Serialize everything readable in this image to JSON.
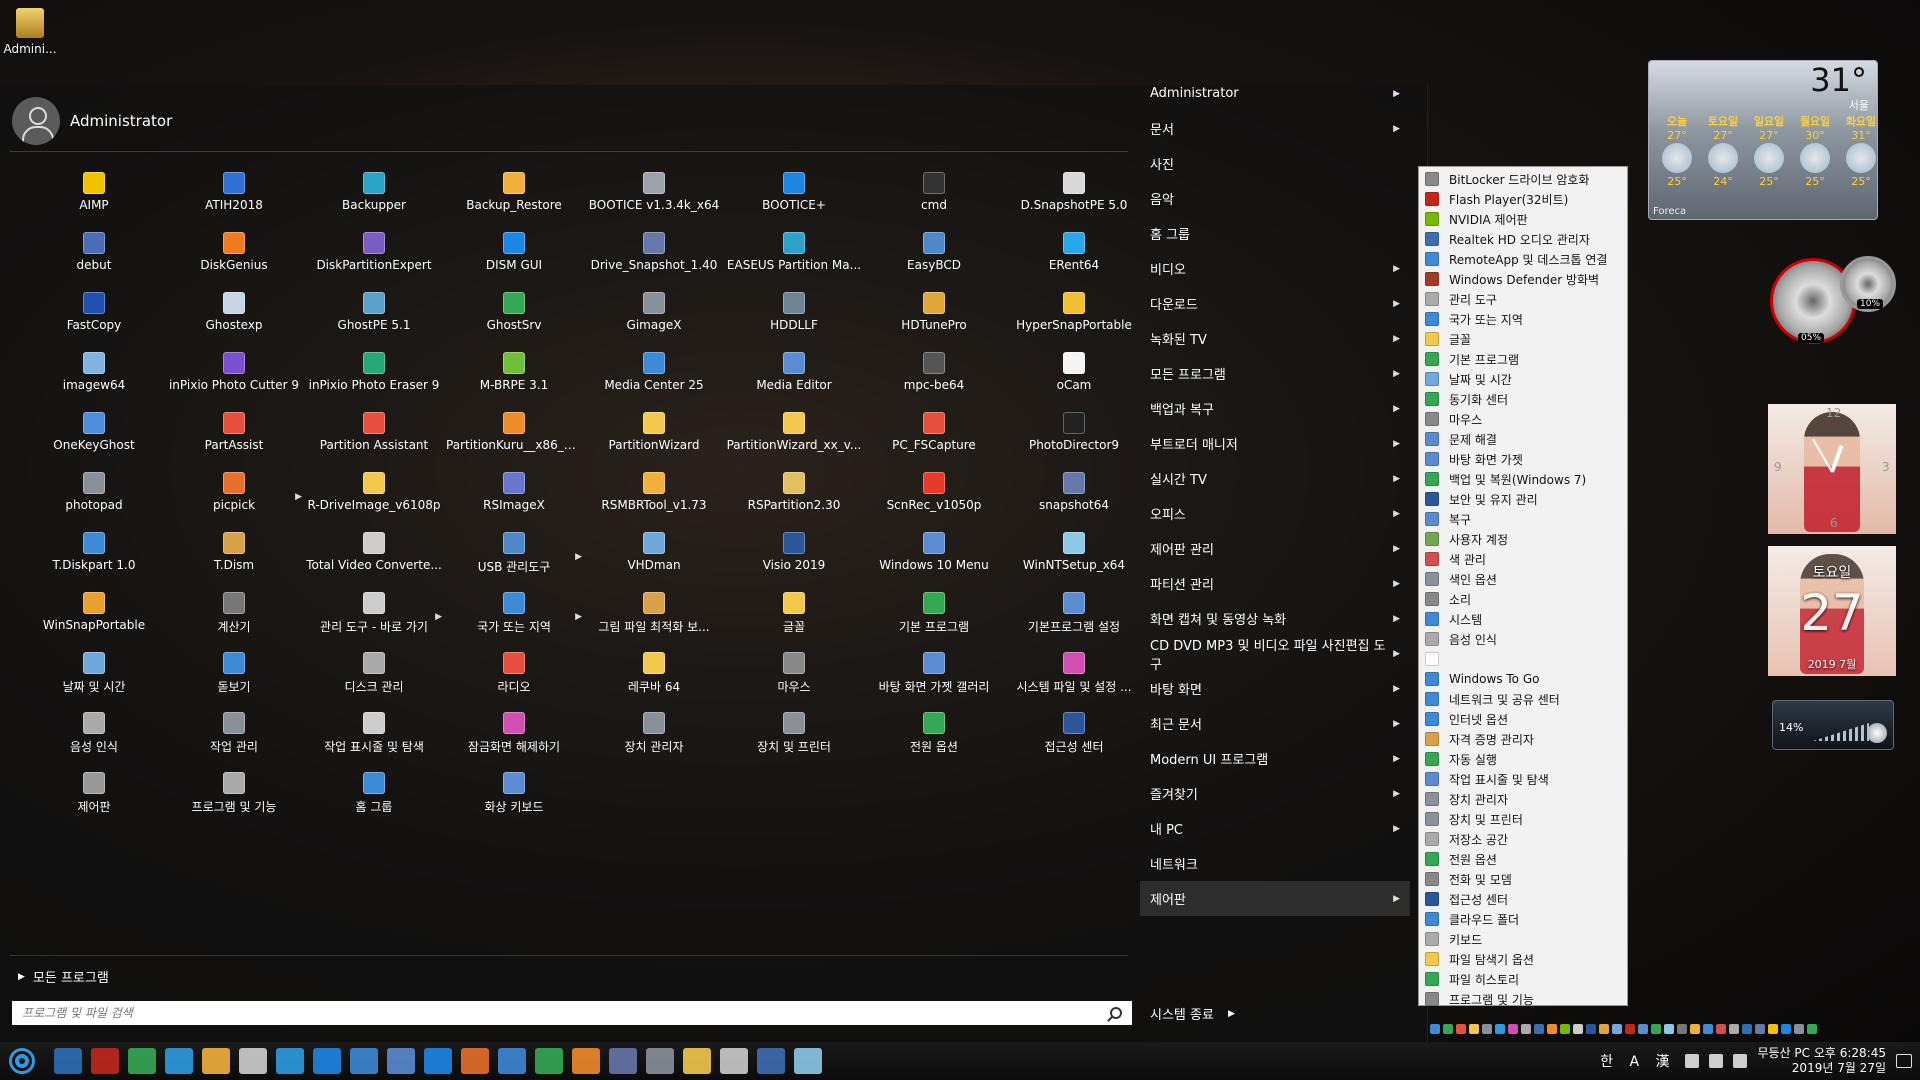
{
  "desktop_icons": [
    {
      "label": "Admini...",
      "icon": "admin-folder-icon"
    }
  ],
  "start_menu": {
    "user_name": "Administrator",
    "apps": [
      {
        "label": "AIMP",
        "color": "#f2c200"
      },
      {
        "label": "ATIH2018",
        "color": "#2f6fd6"
      },
      {
        "label": "Backupper",
        "color": "#2aa3c9"
      },
      {
        "label": "Backup_Restore",
        "color": "#f2b03b"
      },
      {
        "label": "BOOTICE v1.3.4k_x64",
        "color": "#9aa2ab"
      },
      {
        "label": "BOOTICE+",
        "color": "#1d86e3"
      },
      {
        "label": "cmd",
        "color": "#333333"
      },
      {
        "label": "D.SnapshotPE 5.0",
        "color": "#d9d9d9"
      },
      {
        "label": "debut",
        "color": "#4a6fb5"
      },
      {
        "label": "DiskGenius",
        "color": "#f07b1e"
      },
      {
        "label": "DiskPartitionExpert",
        "color": "#7d5cc2"
      },
      {
        "label": "DISM GUI",
        "color": "#1d86e3"
      },
      {
        "label": "Drive_Snapshot_1.40",
        "color": "#6677aa"
      },
      {
        "label": "EASEUS Partition Ma...",
        "color": "#2aa3c9"
      },
      {
        "label": "EasyBCD",
        "color": "#4f88c8"
      },
      {
        "label": "ERent64",
        "color": "#29a7e8"
      },
      {
        "label": "FastCopy",
        "color": "#2050b0"
      },
      {
        "label": "Ghostexp",
        "color": "#c7d6e4"
      },
      {
        "label": "GhostPE 5.1",
        "color": "#5aa0c9"
      },
      {
        "label": "GhostSrv",
        "color": "#34a853"
      },
      {
        "label": "GimageX",
        "color": "#8a9099"
      },
      {
        "label": "HDDLLF",
        "color": "#6f8595"
      },
      {
        "label": "HDTunePro",
        "color": "#e0a63a"
      },
      {
        "label": "HyperSnapPortable",
        "color": "#f0c030"
      },
      {
        "label": "imagew64",
        "color": "#7fb4e0"
      },
      {
        "label": "inPixio Photo Cutter 9",
        "color": "#7c4fd0"
      },
      {
        "label": "inPixio Photo Eraser 9",
        "color": "#27a77a"
      },
      {
        "label": "M-BRPE 3.1",
        "color": "#6fbf3a"
      },
      {
        "label": "Media Center 25",
        "color": "#3d8ad6"
      },
      {
        "label": "Media Editor",
        "color": "#5b8bd0"
      },
      {
        "label": "mpc-be64",
        "color": "#555555"
      },
      {
        "label": "oCam",
        "color": "#f5f5f5"
      },
      {
        "label": "OneKeyGhost",
        "color": "#4c8ed9"
      },
      {
        "label": "PartAssist",
        "color": "#e84f3d"
      },
      {
        "label": "Partition Assistant",
        "color": "#e84f3d"
      },
      {
        "label": "PartitionKuru__x86_x...",
        "color": "#f08b2a"
      },
      {
        "label": "PartitionWizard",
        "color": "#f2c94c"
      },
      {
        "label": "PartitionWizard_xx_v...",
        "color": "#f2c94c"
      },
      {
        "label": "PC_FSCapture",
        "color": "#e84f3d"
      },
      {
        "label": "PhotoDirector9",
        "color": "#222222"
      },
      {
        "label": "photopad",
        "color": "#8a9099"
      },
      {
        "label": "picpick",
        "color": "#e8702a",
        "arrow": true
      },
      {
        "label": "R-DriveImage_v6108p",
        "color": "#f2c94c"
      },
      {
        "label": "RSImageX",
        "color": "#6677cc"
      },
      {
        "label": "RSMBRTool_v1.73",
        "color": "#f2b03b"
      },
      {
        "label": "RSPartition2.30",
        "color": "#e0c060"
      },
      {
        "label": "ScnRec_v1050p",
        "color": "#e83a2a"
      },
      {
        "label": "snapshot64",
        "color": "#6677aa"
      },
      {
        "label": "T.Diskpart 1.0",
        "color": "#3d8ad6"
      },
      {
        "label": "T.Dism",
        "color": "#d9a24a"
      },
      {
        "label": "Total Video Converte...",
        "color": "#cccccc"
      },
      {
        "label": "USB 관리도구",
        "color": "#4f88c8",
        "arrow": true
      },
      {
        "label": "VHDman",
        "color": "#6fa8dc"
      },
      {
        "label": "Visio 2019",
        "color": "#2b579a"
      },
      {
        "label": "Windows 10 Menu",
        "color": "#5b8bd0"
      },
      {
        "label": "WinNTSetup_x64",
        "color": "#8ec9e8"
      },
      {
        "label": "WinSnapPortable",
        "color": "#e8a030"
      },
      {
        "label": "계산기",
        "color": "#777777"
      },
      {
        "label": "관리 도구 - 바로 가기",
        "color": "#cccccc",
        "arrow": true
      },
      {
        "label": "국가 또는 지역",
        "color": "#3d8ad6",
        "arrow": true
      },
      {
        "label": "그림 파일 최적화 보...",
        "color": "#d9a24a"
      },
      {
        "label": "글꼴",
        "color": "#f2c94c"
      },
      {
        "label": "기본 프로그램",
        "color": "#34a853"
      },
      {
        "label": "기본프로그램 설정",
        "color": "#5b8bd0"
      },
      {
        "label": "날짜 및 시간",
        "color": "#6fa8dc"
      },
      {
        "label": "돋보기",
        "color": "#3d8ad6"
      },
      {
        "label": "디스크 관리",
        "color": "#aaaaaa"
      },
      {
        "label": "라디오",
        "color": "#e84f3d"
      },
      {
        "label": "레쿠바 64",
        "color": "#f2c94c"
      },
      {
        "label": "마우스",
        "color": "#888888"
      },
      {
        "label": "바탕 화면 가젯 갤러리",
        "color": "#5b8bd0"
      },
      {
        "label": "시스템 파일 및 설정 ...",
        "color": "#d04fb0"
      },
      {
        "label": "음성 인식",
        "color": "#aaaaaa"
      },
      {
        "label": "작업 관리",
        "color": "#8a9099"
      },
      {
        "label": "작업 표시줄 및 탐색",
        "color": "#cccccc"
      },
      {
        "label": "잠금화면 해제하기",
        "color": "#d04fb0"
      },
      {
        "label": "장치 관리자",
        "color": "#8a9099"
      },
      {
        "label": "장치 및 프린터",
        "color": "#8a9099"
      },
      {
        "label": "전원 옵션",
        "color": "#34a853"
      },
      {
        "label": "접근성 센터",
        "color": "#2b579a"
      },
      {
        "label": "제어판",
        "color": "#999999"
      },
      {
        "label": "프로그램 및 기능",
        "color": "#aaaaaa"
      },
      {
        "label": "홈 그룹",
        "color": "#3d8ad6"
      },
      {
        "label": "화상 키보드",
        "color": "#5b8bd0"
      }
    ],
    "all_programs_label": "모든 프로그램",
    "search_placeholder": "프로그램 및 파일 검색",
    "right_items": [
      {
        "label": "Administrator",
        "arrow": true
      },
      {
        "label": "문서",
        "arrow": true
      },
      {
        "label": "사진",
        "arrow": false
      },
      {
        "label": "음악",
        "arrow": false
      },
      {
        "label": "홈 그룹",
        "arrow": false
      },
      {
        "label": "비디오",
        "arrow": true
      },
      {
        "label": "다운로드",
        "arrow": true
      },
      {
        "label": "녹화된 TV",
        "arrow": true
      },
      {
        "label": "모든 프로그램",
        "arrow": true
      },
      {
        "label": "백업과 복구",
        "arrow": true
      },
      {
        "label": "부트로더 매니저",
        "arrow": true
      },
      {
        "label": "실시간 TV",
        "arrow": true
      },
      {
        "label": "오피스",
        "arrow": true
      },
      {
        "label": "제어판 관리",
        "arrow": true
      },
      {
        "label": "파티션 관리",
        "arrow": true
      },
      {
        "label": "화면 캡쳐 및 동영상 녹화",
        "arrow": true
      },
      {
        "label": "CD DVD MP3 및 비디오 파일 사진편집 도구",
        "arrow": true
      },
      {
        "label": "바탕 화면",
        "arrow": true
      },
      {
        "label": "최근 문서",
        "arrow": true
      },
      {
        "label": "Modern UI 프로그램",
        "arrow": true
      },
      {
        "label": "즐겨찾기",
        "arrow": true
      },
      {
        "label": "내 PC",
        "arrow": true
      },
      {
        "label": "네트워크",
        "arrow": false
      },
      {
        "label": "제어판",
        "arrow": true,
        "selected": true
      }
    ],
    "shutdown_label": "시스템 종료"
  },
  "submenu": {
    "items": [
      {
        "label": "BitLocker 드라이브 암호화",
        "color": "#888888"
      },
      {
        "label": "Flash Player(32비트)",
        "color": "#c0281e"
      },
      {
        "label": "NVIDIA 제어판",
        "color": "#76b900"
      },
      {
        "label": "Realtek HD 오디오 관리자",
        "color": "#3d6fb0"
      },
      {
        "label": "RemoteApp 및 데스크톱 연결",
        "color": "#3d8ad6"
      },
      {
        "label": "Windows Defender 방화벽",
        "color": "#a33a2a"
      },
      {
        "label": "관리 도구",
        "color": "#aaaaaa"
      },
      {
        "label": "국가 또는 지역",
        "color": "#3d8ad6"
      },
      {
        "label": "글꼴",
        "color": "#f2c94c"
      },
      {
        "label": "기본 프로그램",
        "color": "#34a853"
      },
      {
        "label": "날짜 및 시간",
        "color": "#6fa8dc"
      },
      {
        "label": "동기화 센터",
        "color": "#34a853"
      },
      {
        "label": "마우스",
        "color": "#888888"
      },
      {
        "label": "문제 해결",
        "color": "#5b8bd0"
      },
      {
        "label": "바탕 화면 가젯",
        "color": "#5b8bd0"
      },
      {
        "label": "백업 및 복원(Windows 7)",
        "color": "#34a853"
      },
      {
        "label": "보안 및 유지 관리",
        "color": "#2b579a"
      },
      {
        "label": "복구",
        "color": "#5b8bd0"
      },
      {
        "label": "사용자 계정",
        "color": "#6fa84f"
      },
      {
        "label": "색 관리",
        "color": "#d04f4f"
      },
      {
        "label": "색인 옵션",
        "color": "#8a9099"
      },
      {
        "label": "소리",
        "color": "#888888"
      },
      {
        "label": "시스템",
        "color": "#3d8ad6"
      },
      {
        "label": "음성 인식",
        "color": "#aaaaaa"
      },
      {
        "label": "",
        "color": "#ffffff"
      },
      {
        "label": "Windows To Go",
        "color": "#3d8ad6"
      },
      {
        "label": "네트워크 및 공유 센터",
        "color": "#3d8ad6"
      },
      {
        "label": "인터넷 옵션",
        "color": "#3d8ad6"
      },
      {
        "label": "자격 증명 관리자",
        "color": "#d9a24a"
      },
      {
        "label": "자동 실행",
        "color": "#34a853"
      },
      {
        "label": "작업 표시줄 및 탐색",
        "color": "#5b8bd0"
      },
      {
        "label": "장치 관리자",
        "color": "#8a9099"
      },
      {
        "label": "장치 및 프린터",
        "color": "#8a9099"
      },
      {
        "label": "저장소 공간",
        "color": "#aaaaaa"
      },
      {
        "label": "전원 옵션",
        "color": "#34a853"
      },
      {
        "label": "전화 및 모뎀",
        "color": "#888888"
      },
      {
        "label": "접근성 센터",
        "color": "#2b579a"
      },
      {
        "label": "클라우드 폴더",
        "color": "#3d8ad6"
      },
      {
        "label": "키보드",
        "color": "#aaaaaa"
      },
      {
        "label": "파일 탐색기 옵션",
        "color": "#f2c94c"
      },
      {
        "label": "파일 히스토리",
        "color": "#34a853"
      },
      {
        "label": "프로그램 및 기능",
        "color": "#888888"
      }
    ]
  },
  "weather": {
    "temp": "31°",
    "location": "서울",
    "days": [
      {
        "name": "오늘",
        "hi": "27°",
        "lo": "25°"
      },
      {
        "name": "토요일",
        "hi": "27°",
        "lo": "24°"
      },
      {
        "name": "일요일",
        "hi": "27°",
        "lo": "25°"
      },
      {
        "name": "월요일",
        "hi": "30°",
        "lo": "25°"
      },
      {
        "name": "화요일",
        "hi": "31°",
        "lo": "25°"
      }
    ],
    "brand": "Foreca"
  },
  "gauges": {
    "cpu": "05%",
    "ram": "10%"
  },
  "clock_widget": {
    "n12": "12",
    "n3": "3",
    "n6": "6",
    "n9": "9"
  },
  "calendar_widget": {
    "weekday": "토요일",
    "day": "27",
    "year_month": "2019 7월"
  },
  "volume_widget": {
    "percent": "14%"
  },
  "taskbar": {
    "pinned": [
      "#2c6fb5",
      "#c0281e",
      "#34a853",
      "#2c9be0",
      "#f2b03b",
      "#cfcfcf",
      "#2c9be0",
      "#1d86e3",
      "#3d8ad6",
      "#5b8bd0",
      "#1d86e3",
      "#e8702a",
      "#3d8ad6",
      "#34a853",
      "#f08b2a",
      "#6677aa",
      "#8a9099",
      "#f2c94c",
      "#cccccc",
      "#3d6fb0",
      "#8ec9e8"
    ],
    "ime": "한 A 漢",
    "pc_name": "무등산 PC 오후 6:28:45",
    "date": "2019년 7월 27일"
  }
}
